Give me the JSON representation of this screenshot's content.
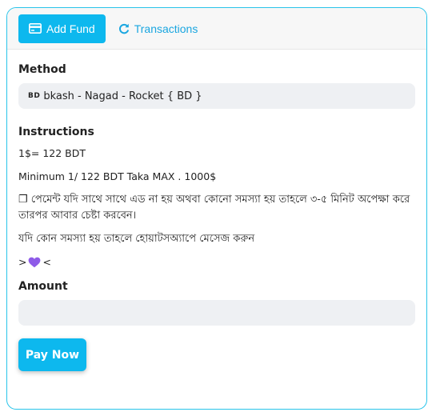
{
  "header": {
    "add_fund_label": "Add Fund",
    "transactions_label": "Transactions",
    "add_fund_icon": "credit-card-icon",
    "transactions_icon": "refresh-icon"
  },
  "method": {
    "label": "Method",
    "flag_text": "BD",
    "value": "bkash - Nagad - Rocket { BD }"
  },
  "instructions": {
    "label": "Instructions",
    "lines": [
      "1$= 122 BDT",
      "Minimum 1/ 122 BDT Taka MAX . 1000$",
      "❐ পেমেন্ট যদি সাথে সাথে এড না হয় অথবা কোনো সমস্যা হয় তাহলে ৩-৫ মিনিট অপেক্ষা করে তারপর আবার চেষ্টা করবেন।",
      "যদি কোন সমস্যা হয় তাহলে হোয়াটসঅ্যাপে মেসেজ করুন"
    ],
    "heart_prefix": ">",
    "heart_suffix": "<"
  },
  "amount": {
    "label": "Amount",
    "value": "",
    "placeholder": ""
  },
  "pay_button_label": "Pay Now",
  "colors": {
    "accent": "#0db8ee",
    "border": "#29c4ea",
    "field_bg": "#eef0f3",
    "heart": "#8e5be8"
  }
}
